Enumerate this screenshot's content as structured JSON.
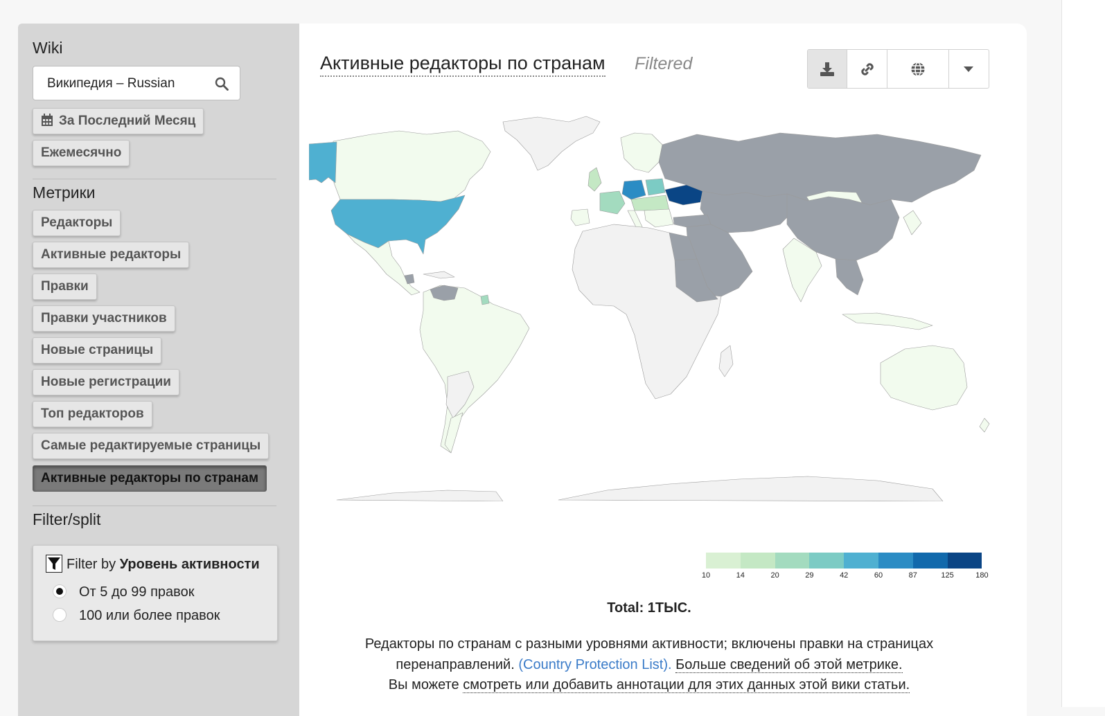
{
  "sidebar": {
    "wiki_section_title": "Wiki",
    "wiki_selected": "Википедия – Russian",
    "time_range_button": "За Последний Месяц",
    "granularity_button": "Ежемесячно",
    "metrics_title": "Метрики",
    "metrics": [
      {
        "label": "Редакторы",
        "active": false
      },
      {
        "label": "Активные редакторы",
        "active": false
      },
      {
        "label": "Правки",
        "active": false
      },
      {
        "label": "Правки участников",
        "active": false
      },
      {
        "label": "Новые страницы",
        "active": false
      },
      {
        "label": "Новые регистрации",
        "active": false
      },
      {
        "label": "Топ редакторов",
        "active": false
      },
      {
        "label": "Самые редактируемые страницы",
        "active": false
      },
      {
        "label": "Активные редакторы по странам",
        "active": true
      }
    ],
    "filter_title": "Filter/split",
    "filter_by_prefix": "Filter by",
    "filter_by_dimension": "Уровень активности",
    "filter_options": [
      {
        "label": "От 5 до 99 правок",
        "selected": true
      },
      {
        "label": "100 или более правок",
        "selected": false
      }
    ]
  },
  "main": {
    "title": "Активные редакторы по странам",
    "filtered_tag": "Filtered",
    "toolbar": [
      "download-icon",
      "link-icon",
      "globe-icon",
      "caret-down-icon"
    ],
    "total": "Total: 1ТЫС.",
    "desc_line1": "Редакторы по странам с разными уровнями активности; включены правки на страницах",
    "desc_line2_prefix": "перенаправлений.",
    "desc_country_link": "(Country Protection List).",
    "desc_more": "Больше сведений об этой метрике.",
    "desc_line3_prefix": "Вы можете",
    "desc_annotations": "смотреть или добавить аннотации для этих данных этой вики статьи."
  },
  "chart_data": {
    "type": "choropleth",
    "scale": {
      "ticks": [
        "10",
        "14",
        "20",
        "29",
        "42",
        "60",
        "87",
        "125",
        "180"
      ],
      "colors": [
        "#d9f0d3",
        "#c4e8c4",
        "#a3dbbf",
        "#7ccbc4",
        "#4fb0d1",
        "#2b8cc4",
        "#1169ac",
        "#0a4585"
      ]
    },
    "no_data_color": "#f2f2f2",
    "outside_range_color": "#9aa0a8",
    "legend_position": "bottom-right"
  }
}
